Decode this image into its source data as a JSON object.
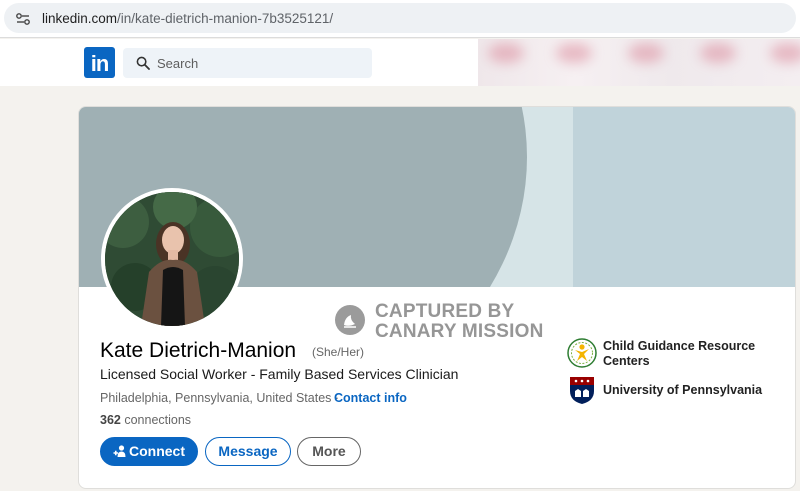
{
  "browser": {
    "url_domain": "linkedin.com",
    "url_path": "/in/kate-dietrich-manion-7b3525121/"
  },
  "nav": {
    "logo_text": "in",
    "search_placeholder": "Search"
  },
  "watermark": {
    "line1": "CAPTURED BY",
    "line2": "CANARY MISSION"
  },
  "profile": {
    "name": "Kate Dietrich-Manion",
    "pronouns": "(She/Her)",
    "headline": "Licensed Social Worker - Family Based Services Clinician",
    "location": "Philadelphia, Pennsylvania, United States",
    "separator": " · ",
    "contact_info_label": "Contact info",
    "connections_count": "362",
    "connections_label": " connections"
  },
  "actions": {
    "connect_label": "Connect",
    "message_label": "Message",
    "more_label": "More"
  },
  "organizations": [
    {
      "name": "Child Guidance Resource Centers",
      "icon": "cgrc-logo-icon"
    },
    {
      "name": "University of Pennsylvania",
      "icon": "upenn-shield-icon"
    }
  ],
  "colors": {
    "linkedin_blue": "#0a66c2",
    "page_background": "#f4f2ee",
    "banner_light": "#c0d3da",
    "banner_dark": "#9fb0b4",
    "penn_red": "#990000",
    "penn_blue": "#011f5b"
  }
}
